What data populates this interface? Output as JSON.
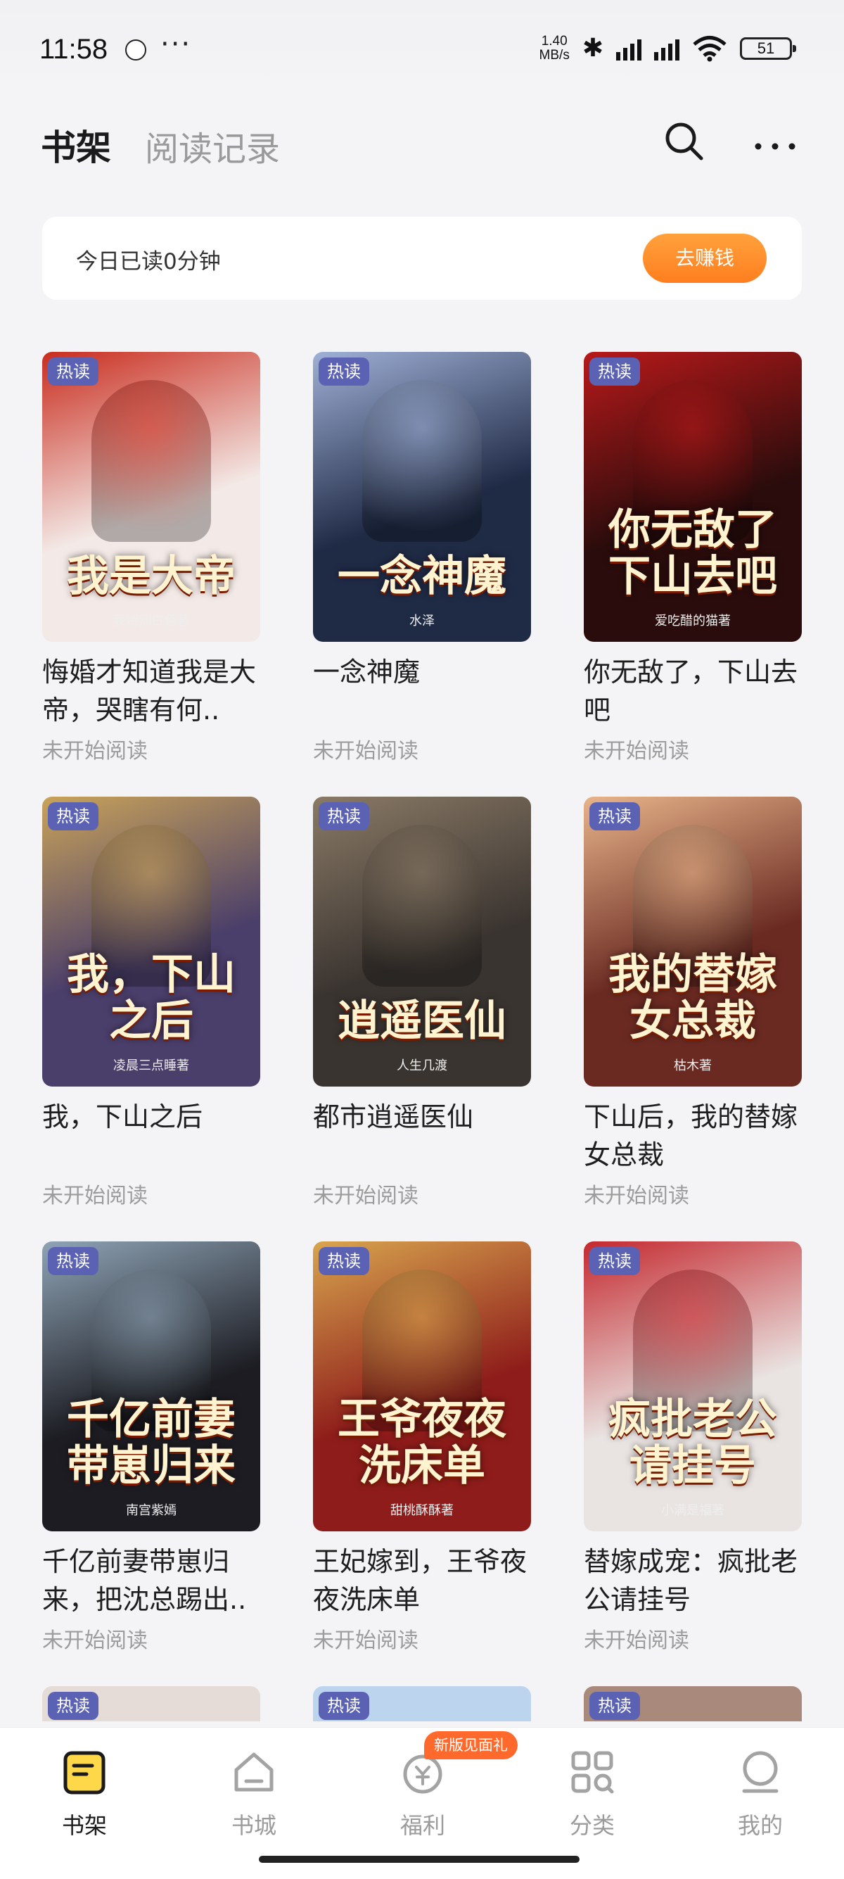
{
  "status_bar": {
    "time": "11:58",
    "speed_value": "1.40",
    "speed_unit": "MB/s",
    "battery": "51"
  },
  "header": {
    "tab_bookshelf": "书架",
    "tab_history": "阅读记录"
  },
  "reading_card": {
    "text": "今日已读0分钟",
    "button": "去赚钱"
  },
  "books": [
    {
      "badge": "热读",
      "cover_text": "我是大帝",
      "cover_author": "我特别白色著",
      "title": "悔婚才知道我是大帝，哭瞎有何..",
      "status": "未开始阅读",
      "colors": [
        "#f3e9e6",
        "#c92c1e"
      ]
    },
    {
      "badge": "热读",
      "cover_text": "一念神魔",
      "cover_author": "水泽",
      "title": "一念神魔",
      "status": "未开始阅读",
      "colors": [
        "#1f2a45",
        "#9fb0d6"
      ]
    },
    {
      "badge": "热读",
      "cover_text": "你无敌了下山去吧",
      "cover_author": "爱吃醋的猫著",
      "title": "你无敌了，下山去吧",
      "status": "未开始阅读",
      "colors": [
        "#2a0c0c",
        "#b8191a"
      ]
    },
    {
      "badge": "热读",
      "cover_text": "我，下山之后",
      "cover_author": "凌晨三点睡著",
      "title": "我，下山之后",
      "status": "未开始阅读",
      "colors": [
        "#4a3e6a",
        "#c9a35a"
      ]
    },
    {
      "badge": "热读",
      "cover_text": "逍遥医仙",
      "cover_author": "人生几渡",
      "title": "都市逍遥医仙",
      "status": "未开始阅读",
      "colors": [
        "#3a3430",
        "#8a7a66"
      ]
    },
    {
      "badge": "热读",
      "cover_text": "我的替嫁女总裁",
      "cover_author": "枯木著",
      "title": "下山后，我的替嫁女总裁",
      "status": "未开始阅读",
      "colors": [
        "#6a2a22",
        "#e8b48a"
      ]
    },
    {
      "badge": "热读",
      "cover_text": "千亿前妻带崽归来",
      "cover_author": "南宫紫嫣",
      "title": "千亿前妻带崽归来，把沈总踢出..",
      "status": "未开始阅读",
      "colors": [
        "#1c1c22",
        "#8fa4b6"
      ]
    },
    {
      "badge": "热读",
      "cover_text": "王爷夜夜洗床单",
      "cover_author": "甜桃酥酥著",
      "title": "王妃嫁到，王爷夜夜洗床单",
      "status": "未开始阅读",
      "colors": [
        "#8e1c1a",
        "#d8a54e"
      ]
    },
    {
      "badge": "热读",
      "cover_text": "疯批老公请挂号",
      "cover_author": "小满是福著",
      "title": "替嫁成宠：疯批老公请挂号",
      "status": "未开始阅读",
      "colors": [
        "#e9e4e2",
        "#c4282e"
      ]
    }
  ],
  "partial_badges": [
    "热读",
    "热读",
    "热读"
  ],
  "bottom_nav": {
    "promo_badge": "新版见面礼",
    "items": [
      {
        "label": "书架",
        "icon": "bookshelf-icon"
      },
      {
        "label": "书城",
        "icon": "store-icon"
      },
      {
        "label": "福利",
        "icon": "yen-bag-icon"
      },
      {
        "label": "分类",
        "icon": "category-icon"
      },
      {
        "label": "我的",
        "icon": "profile-icon"
      }
    ]
  }
}
